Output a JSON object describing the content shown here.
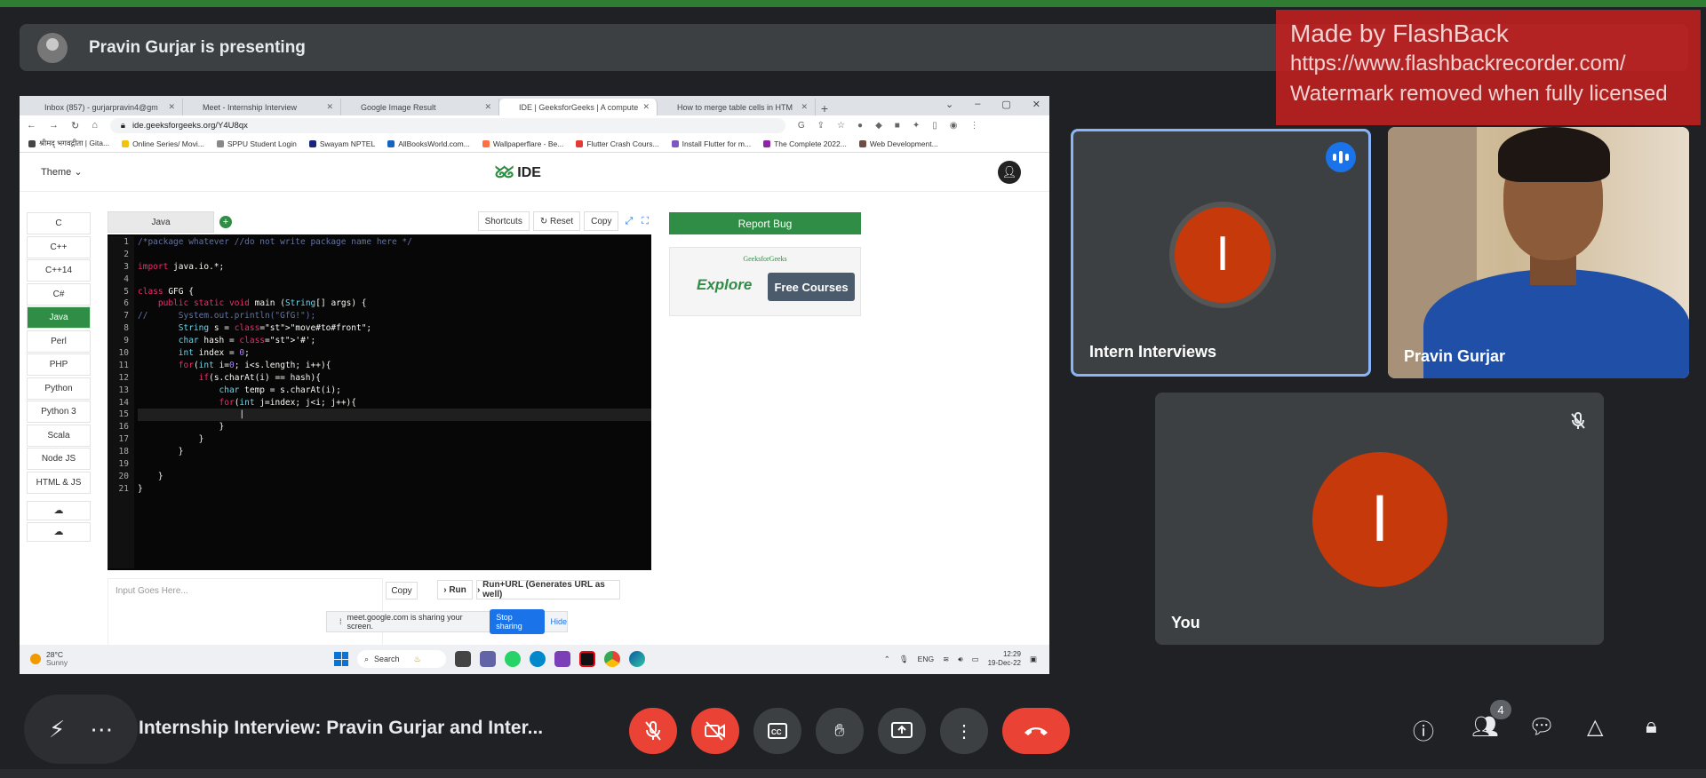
{
  "presenter": {
    "text": "Pravin Gurjar is presenting"
  },
  "watermark": {
    "line1": "Made by FlashBack",
    "line2": "https://www.flashbackrecorder.com/",
    "line3": "Watermark removed when fully licensed"
  },
  "browser": {
    "tabs": [
      {
        "label": "Inbox (857) - gurjarpravin4@gm",
        "color": "#ea4335"
      },
      {
        "label": "Meet - Internship Interview",
        "color": "#f29900"
      },
      {
        "label": "Google Image Result",
        "color": "#4285f4"
      },
      {
        "label": "IDE | GeeksforGeeks | A compute",
        "color": "#2f8d46"
      },
      {
        "label": "How to merge table cells in HTM",
        "color": "#2f8d46"
      }
    ],
    "new_tab": "+",
    "url": "ide.geeksforgeeks.org/Y4U8qx",
    "bookmarks": [
      {
        "label": "श्रीमद् भगवद्गीता | Gita...",
        "color": "#444"
      },
      {
        "label": "Online Series/ Movi...",
        "color": "#f4c20d"
      },
      {
        "label": "SPPU Student Login",
        "color": "#888"
      },
      {
        "label": "Swayam NPTEL",
        "color": "#1a237e"
      },
      {
        "label": "AllBooksWorld.com...",
        "color": "#1565c0"
      },
      {
        "label": "Wallpaperflare - Be...",
        "color": "#ff7043"
      },
      {
        "label": "Flutter Crash Cours...",
        "color": "#e53935"
      },
      {
        "label": "Install Flutter for m...",
        "color": "#7e57c2"
      },
      {
        "label": "The Complete 2022...",
        "color": "#8e24aa"
      },
      {
        "label": "Web Development...",
        "color": "#6d4c41"
      }
    ]
  },
  "ide": {
    "theme_label": "Theme",
    "logo_text": "IDE",
    "logo_mark": "ᘜᘜ",
    "languages": [
      "C",
      "C++",
      "C++14",
      "C#",
      "Java",
      "Perl",
      "PHP",
      "Python",
      "Python 3",
      "Scala",
      "Node JS",
      "HTML & JS"
    ],
    "active_language": "Java",
    "editor_tab": "Java",
    "actions": {
      "shortcuts": "Shortcuts",
      "reset": "Reset",
      "copy": "Copy"
    },
    "report_bug": "Report Bug",
    "ad": {
      "brand": "GeeksforGeeks",
      "explore": "Explore",
      "courses": "Free Courses"
    },
    "input_placeholder": "Input Goes Here...",
    "copy_input": "Copy",
    "run": "Run",
    "run_url": "Run+URL (Generates URL as well)",
    "code_lines": [
      "/*package whatever //do not write package name here */",
      "",
      "import java.io.*;",
      "",
      "class GFG {",
      "    public static void main (String[] args) {",
      "//      System.out.println(\"GfG!\");",
      "        String s = \"move#to#front\";",
      "        char hash = '#';",
      "        int index = 0;",
      "        for(int i=0; i<s.length; i++){",
      "            if(s.charAt(i) == hash){",
      "                char temp = s.charAt(i);",
      "                for(int j=index; j<i; j++){",
      "                    |",
      "                }",
      "            }",
      "        }",
      "",
      "    }",
      "}"
    ]
  },
  "share_bar": {
    "text": "meet.google.com is sharing your screen.",
    "stop": "Stop sharing",
    "hide": "Hide"
  },
  "taskbar": {
    "temp": "28°C",
    "condition": "Sunny",
    "search": "Search",
    "lang": "ENG",
    "time": "12:29",
    "date": "19-Dec-22"
  },
  "participants": [
    {
      "name": "Intern Interviews",
      "initial": "I"
    },
    {
      "name": "Pravin Gurjar"
    },
    {
      "name": "You",
      "initial": "I"
    }
  ],
  "meeting": {
    "title": "Internship Interview: Pravin Gurjar and Inter..."
  },
  "people_count": "4",
  "colors": {
    "end_call": "#ea4335",
    "mic_off": "#ea4335",
    "avatar": "#c5390a",
    "active_speaker": "#8ab4f8"
  }
}
